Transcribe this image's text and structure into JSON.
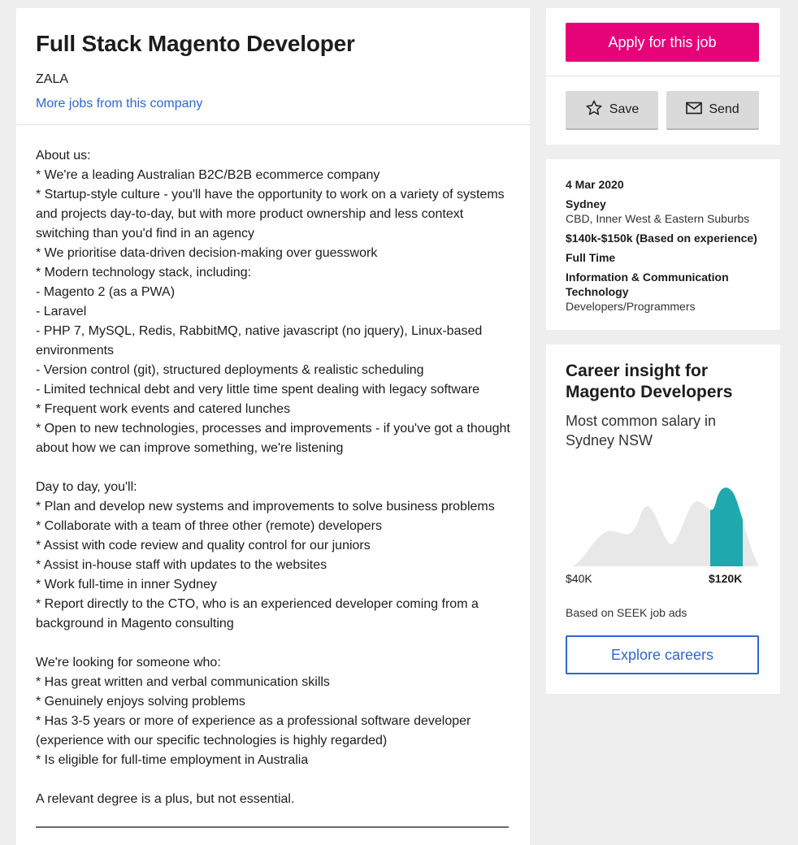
{
  "job": {
    "title": "Full Stack Magento Developer",
    "company": "ZALA",
    "more_jobs_link": "More jobs from this company"
  },
  "description": [
    "About us:",
    "* We're a leading Australian B2C/B2B ecommerce company",
    "* Startup-style culture - you'll have the opportunity to work on a variety of systems and projects day-to-day, but with more product ownership and less context switching than you'd find in an agency",
    "* We prioritise data-driven decision-making over guesswork",
    "* Modern technology stack, including:",
    "- Magento 2 (as a PWA)",
    "- Laravel",
    "- PHP 7, MySQL, Redis, RabbitMQ, native javascript (no jquery), Linux-based environments",
    "- Version control (git), structured deployments & realistic scheduling",
    "- Limited technical debt and very little time spent dealing with legacy software",
    "* Frequent work events and catered lunches",
    "* Open to new technologies, processes and improvements - if you've got a thought about how we can improve something, we're listening",
    "",
    "Day to day, you'll:",
    "* Plan and develop new systems and improvements to solve business problems",
    "* Collaborate with a team of three other (remote) developers",
    "* Assist with code review and quality control for our juniors",
    "* Assist in-house staff with updates to the websites",
    "* Work full-time in inner Sydney",
    "* Report directly to the CTO, who is an experienced developer coming from a background in Magento consulting",
    "",
    "We're looking for someone who:",
    "* Has great written and verbal communication skills",
    "* Genuinely enjoys solving problems",
    "* Has 3-5 years or more of experience as a professional software developer (experience with our specific technologies is highly regarded)",
    "* Is eligible for full-time employment in Australia",
    "",
    "A relevant degree is a plus, but not essential."
  ],
  "actions": {
    "apply_label": "Apply for this job",
    "save_label": "Save",
    "send_label": "Send",
    "apply_color": "#e60278"
  },
  "meta": {
    "date": "4 Mar 2020",
    "location": "Sydney",
    "area": "CBD, Inner West & Eastern Suburbs",
    "salary": "$140k-$150k (Based on experience)",
    "work_type": "Full Time",
    "classification": "Information & Communication Technology",
    "subclassification": "Developers/Programmers"
  },
  "insight": {
    "title": "Career insight for Magento Developers",
    "subtitle": "Most common salary in Sydney NSW",
    "low_label": "$40K",
    "high_label": "$120K",
    "based_on": "Based on SEEK job ads",
    "explore_label": "Explore careers",
    "highlight_color": "#1fa8ad"
  }
}
